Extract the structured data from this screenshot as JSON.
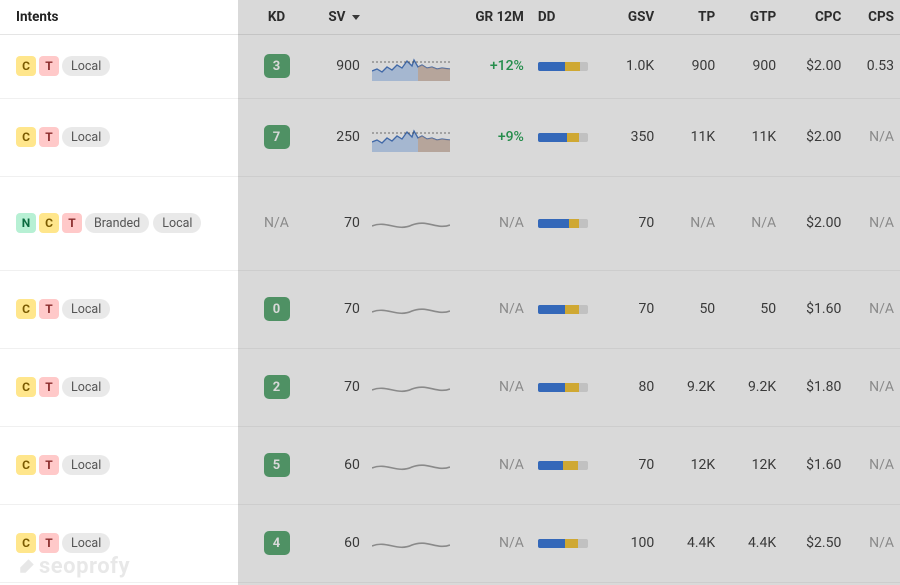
{
  "columns": {
    "intents": "Intents",
    "kd": "KD",
    "sv": "SV",
    "gr12m": "GR 12M",
    "dd": "DD",
    "gsv": "GSV",
    "tp": "TP",
    "gtp": "GTP",
    "cpc": "CPC",
    "cps": "CPS"
  },
  "intent_letters": {
    "C": "C",
    "T": "T",
    "N": "N"
  },
  "tag_labels": {
    "branded": "Branded",
    "local": "Local"
  },
  "rows": [
    {
      "intents": [
        "C",
        "T"
      ],
      "tags": [
        "local"
      ],
      "kd": "3",
      "sv": "900",
      "gr12m": "+12%",
      "gr_pos": true,
      "spark": "blue",
      "dd_blue": 55,
      "dd_yellow": 30,
      "gsv": "1.0K",
      "tp": "900",
      "gtp": "900",
      "cpc": "$2.00",
      "cps": "0.53"
    },
    {
      "intents": [
        "C",
        "T"
      ],
      "tags": [
        "local"
      ],
      "kd": "7",
      "sv": "250",
      "gr12m": "+9%",
      "gr_pos": true,
      "spark": "blue",
      "dd_blue": 58,
      "dd_yellow": 25,
      "gsv": "350",
      "tp": "11K",
      "gtp": "11K",
      "cpc": "$2.00",
      "cps": "N/A"
    },
    {
      "intents": [
        "N",
        "C",
        "T"
      ],
      "tags": [
        "branded",
        "local"
      ],
      "tall": true,
      "kd": "N/A",
      "sv": "70",
      "gr12m": "N/A",
      "spark": "flat",
      "dd_blue": 62,
      "dd_yellow": 20,
      "gsv": "70",
      "tp": "N/A",
      "gtp": "N/A",
      "cpc": "$2.00",
      "cps": "N/A"
    },
    {
      "intents": [
        "C",
        "T"
      ],
      "tags": [
        "local"
      ],
      "kd": "0",
      "sv": "70",
      "gr12m": "N/A",
      "spark": "flat",
      "dd_blue": 55,
      "dd_yellow": 28,
      "gsv": "70",
      "tp": "50",
      "gtp": "50",
      "cpc": "$1.60",
      "cps": "N/A"
    },
    {
      "intents": [
        "C",
        "T"
      ],
      "tags": [
        "local"
      ],
      "kd": "2",
      "sv": "70",
      "gr12m": "N/A",
      "spark": "flat",
      "dd_blue": 55,
      "dd_yellow": 28,
      "gsv": "80",
      "tp": "9.2K",
      "gtp": "9.2K",
      "cpc": "$1.80",
      "cps": "N/A"
    },
    {
      "intents": [
        "C",
        "T"
      ],
      "tags": [
        "local"
      ],
      "kd": "5",
      "sv": "60",
      "gr12m": "N/A",
      "spark": "flat",
      "dd_blue": 50,
      "dd_yellow": 30,
      "gsv": "70",
      "tp": "12K",
      "gtp": "12K",
      "cpc": "$1.60",
      "cps": "N/A"
    },
    {
      "intents": [
        "C",
        "T"
      ],
      "tags": [
        "local"
      ],
      "kd": "4",
      "sv": "60",
      "gr12m": "N/A",
      "spark": "flat",
      "dd_blue": 55,
      "dd_yellow": 25,
      "gsv": "100",
      "tp": "4.4K",
      "gtp": "4.4K",
      "cpc": "$2.50",
      "cps": "N/A"
    }
  ],
  "watermark": "seoprofy"
}
